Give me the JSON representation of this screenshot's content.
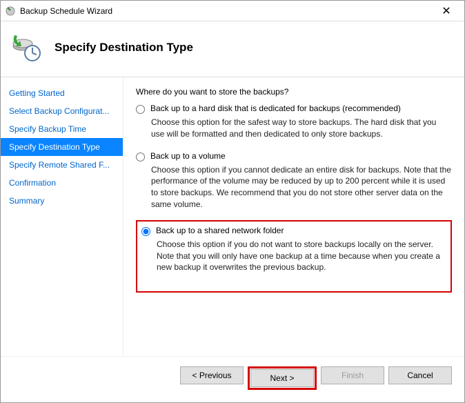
{
  "window": {
    "title": "Backup Schedule Wizard"
  },
  "header": {
    "title": "Specify Destination Type"
  },
  "sidebar": {
    "steps": [
      {
        "label": "Getting Started",
        "active": false
      },
      {
        "label": "Select Backup Configurat...",
        "active": false
      },
      {
        "label": "Specify Backup Time",
        "active": false
      },
      {
        "label": "Specify Destination Type",
        "active": true
      },
      {
        "label": "Specify Remote Shared F...",
        "active": false
      },
      {
        "label": "Confirmation",
        "active": false
      },
      {
        "label": "Summary",
        "active": false
      }
    ]
  },
  "content": {
    "question": "Where do you want to store the backups?",
    "options": [
      {
        "label": "Back up to a hard disk that is dedicated for backups (recommended)",
        "desc": "Choose this option for the safest way to store backups. The hard disk that you use will be formatted and then dedicated to only store backups.",
        "selected": false,
        "highlighted": false
      },
      {
        "label": "Back up to a volume",
        "desc": "Choose this option if you cannot dedicate an entire disk for backups. Note that the performance of the volume may be reduced by up to 200 percent while it is used to store backups. We recommend that you do not store other server data on the same volume.",
        "selected": false,
        "highlighted": false
      },
      {
        "label": "Back up to a shared network folder",
        "desc": "Choose this option if you do not want to store backups locally on the server. Note that you will only have one backup at a time because when you create a new backup it overwrites the previous backup.",
        "selected": true,
        "highlighted": true
      }
    ]
  },
  "footer": {
    "previous": "< Previous",
    "next": "Next >",
    "finish": "Finish",
    "cancel": "Cancel",
    "highlighted_button": "next"
  }
}
